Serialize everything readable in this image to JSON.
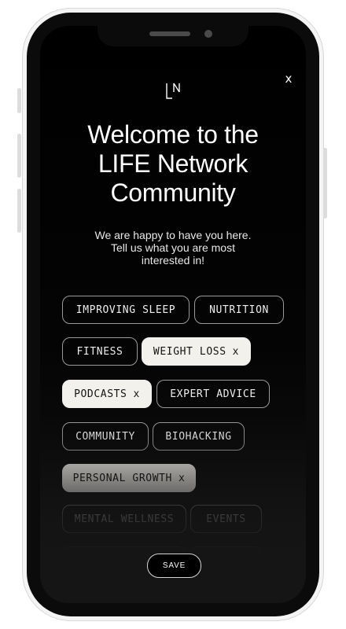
{
  "app": {
    "logo_text": "LN",
    "close_label": "x",
    "title": "Welcome to the\nLIFE Network\nCommunity",
    "subtitle": "We are happy to have you here.\nTell us what you are most\ninterested in!",
    "save_label": "SAVE"
  },
  "chips": [
    {
      "label": "IMPROVING SLEEP",
      "selected": false
    },
    {
      "label": "NUTRITION",
      "selected": false
    },
    {
      "label": "FITNESS",
      "selected": false
    },
    {
      "label": "WEIGHT LOSS",
      "selected": true
    },
    {
      "label": "PODCASTS",
      "selected": true
    },
    {
      "label": "EXPERT ADVICE",
      "selected": false
    },
    {
      "label": "COMMUNITY",
      "selected": false
    },
    {
      "label": "BIOHACKING",
      "selected": false
    },
    {
      "label": "PERSONAL GROWTH",
      "selected": true
    },
    {
      "label": "MENTAL WELLNESS",
      "selected": false
    },
    {
      "label": "EVENTS",
      "selected": false
    }
  ],
  "chip_remove_glyph": "x",
  "colors": {
    "screen_bg": "#000000",
    "chip_border": "#9a9a9a",
    "chip_selected_bg": "#f3f1ec",
    "text_primary": "#ffffff"
  }
}
